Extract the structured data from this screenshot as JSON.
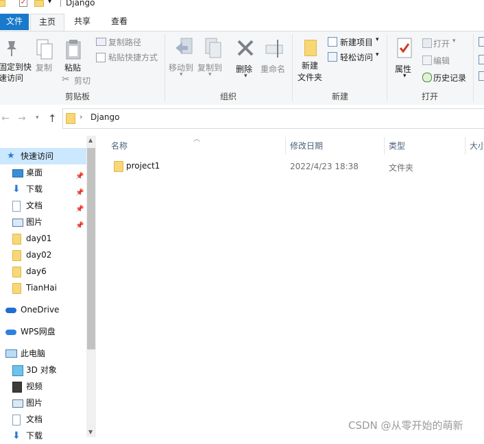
{
  "window": {
    "title": "Django"
  },
  "tabs": {
    "file": "文件",
    "home": "主页",
    "share": "共享",
    "view": "查看"
  },
  "ribbon": {
    "clipboard": {
      "label": "剪贴板",
      "pin_quick": "固定到快\n速访问",
      "copy": "复制",
      "paste": "粘贴",
      "copy_path": "复制路径",
      "paste_shortcut": "粘贴快捷方式",
      "cut": "剪切"
    },
    "organize": {
      "label": "组织",
      "move_to": "移动到",
      "copy_to": "复制到",
      "delete": "删除",
      "rename": "重命名"
    },
    "new": {
      "label": "新建",
      "new_folder": "新建\n文件夹",
      "new_item": "新建项目",
      "easy_access": "轻松访问"
    },
    "open": {
      "label": "打开",
      "properties": "属性",
      "open": "打开",
      "edit": "编辑",
      "history": "历史记录"
    }
  },
  "address": {
    "path": "Django"
  },
  "nav": {
    "quick_access": "快速访问",
    "items": [
      "桌面",
      "下载",
      "文档",
      "图片",
      "day01",
      "day02",
      "day6",
      "TianHai"
    ],
    "onedrive": "OneDrive",
    "wps": "WPS网盘",
    "this_pc": "此电脑",
    "pc_items": [
      "3D 对象",
      "视频",
      "图片",
      "文档",
      "下载"
    ]
  },
  "columns": {
    "name": "名称",
    "modified": "修改日期",
    "type": "类型",
    "size": "大小"
  },
  "files": [
    {
      "name": "project1",
      "modified": "2022/4/23 18:38",
      "type": "文件夹"
    }
  ],
  "watermark": "CSDN @从零开始的萌新",
  "colors": {
    "accent": "#1979ca",
    "folder": "#f8d775"
  }
}
